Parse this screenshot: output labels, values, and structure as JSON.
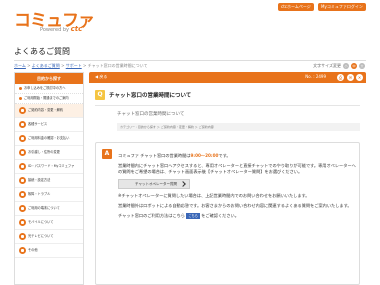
{
  "header": {
    "logo_text": "コミュファ",
    "logo_sub": "Powered by",
    "logo_brand": "ctc",
    "buttons": [
      "ctcホームページ",
      "Myコミュファログイン"
    ]
  },
  "page": {
    "title": "よくあるご質問",
    "breadcrumb": [
      "ホーム",
      "よくあるご質問",
      "サポート",
      "チャット窓口の営業時間について"
    ]
  },
  "font_size": {
    "label": "文字サイズ変更",
    "options": [
      "小",
      "中",
      "大"
    ]
  },
  "sidebar": {
    "header": "目的から探す",
    "plain_items": [
      "お申し込みをご検討中の方へ",
      "ご利用開始・開通までのご案内"
    ],
    "category_items": [
      "ご契約内容・変更・解約",
      "各種サービス",
      "ご利用料金の確認・お支払い",
      "お引越し・住所の変更",
      "ID・パスワード・Myコミュファ",
      "接続・設定方法",
      "故障・トラブル",
      "ご利用の端末について",
      "モバイルについて",
      "光テレビについて",
      "その他"
    ]
  },
  "main": {
    "back_label": "戻る",
    "number": "No. : 2499",
    "question": {
      "title": "チャット窓口の営業時間について",
      "subtitle": "チャット窓口の営業時間について",
      "tags": "カテゴリー : 目的から探す ＞ ご契約内容・変更・解約 ＞ ご契約内容"
    },
    "answer": {
      "line1_pre": "コミュファ チャット窓口の営業時間は",
      "line1_hours": "9:00～20:00",
      "line1_post": "です。",
      "para2": "営業時間内にチャット窓口へアクセスすると、専用オペレーターと直接チャットでのやり取りが可能です。専用オペレーターへの質問をご希望の場合は、チャット画面表示後【チャットオペレーター質問】をお選びください。",
      "operator_button": "チャットオペレーター質問",
      "note": "※チャットオペレーターに質問したい場合は、上記営業時間内でのお問い合わせをお願いいたします。",
      "para3": "営業時間外はロボットによる自動応答です。お客さまからのお問い合わせ内容に関連するよくある質問をご案内いたします。",
      "para4_pre": "チャット窓口のご利用方法はこちら",
      "para4_link": "こちら",
      "para4_post": "をご確認ください。"
    }
  }
}
